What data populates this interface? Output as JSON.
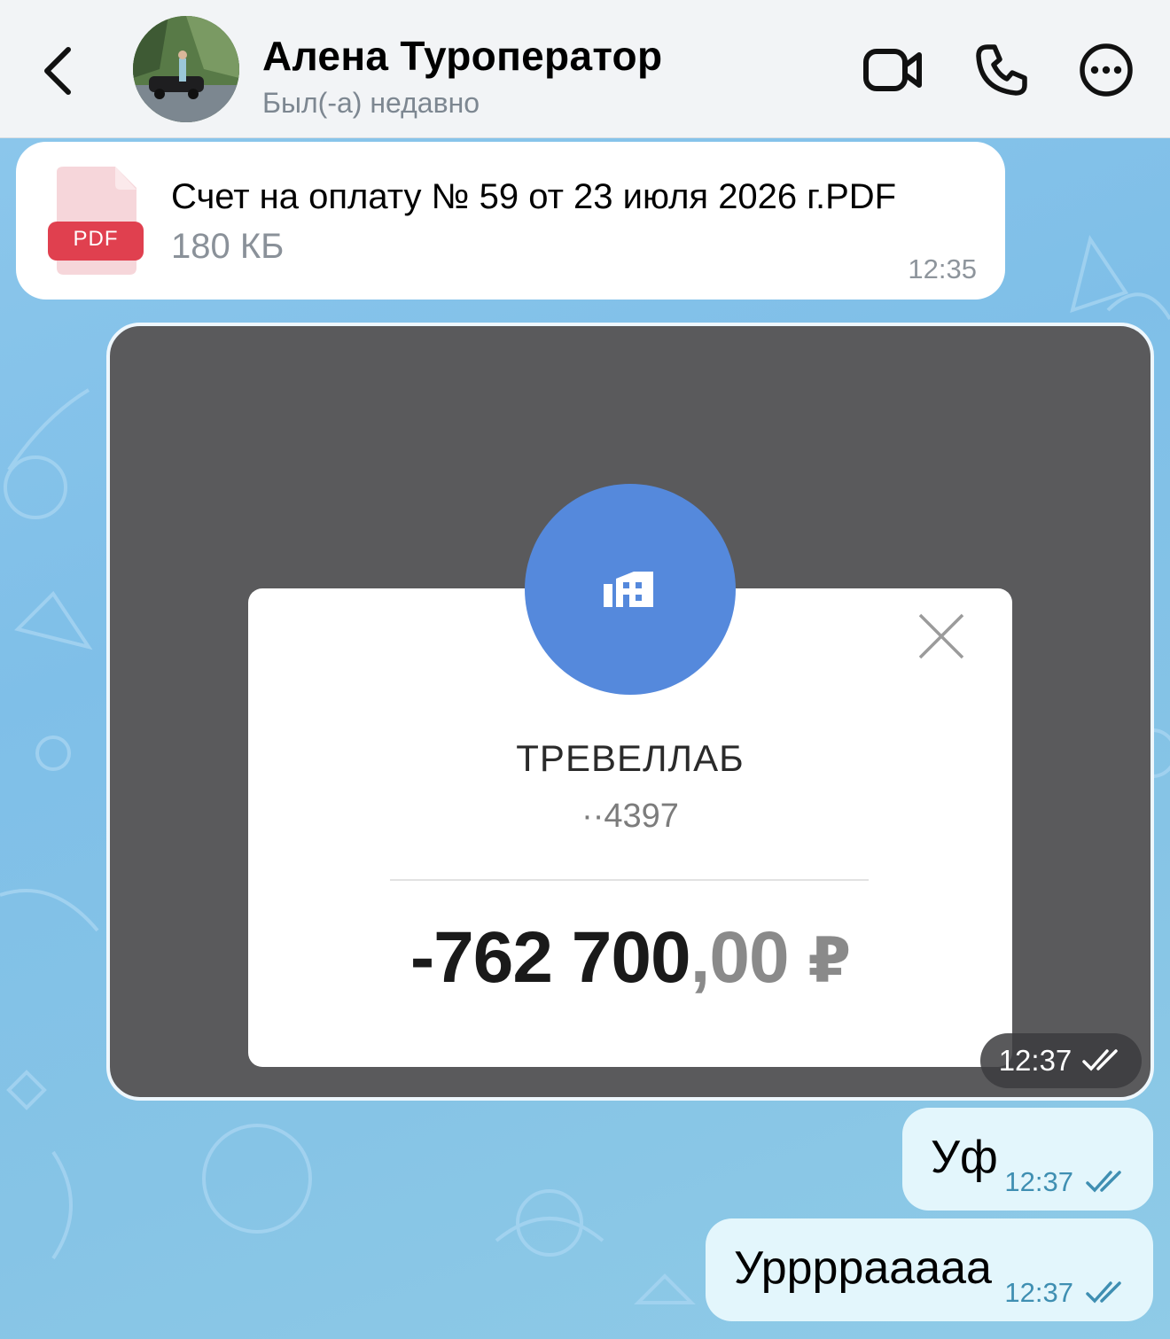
{
  "header": {
    "contact_name": "Алена Туроператор",
    "status": "Был(-а) недавно"
  },
  "messages": {
    "file": {
      "type_badge": "PDF",
      "name": "Счет на оплату № 59 от 23 июля 2026 г.PDF",
      "size": "180 КБ",
      "time": "12:35"
    },
    "image": {
      "time": "12:37",
      "receipt": {
        "merchant": "ТРЕВЕЛЛАБ",
        "account": "··4397",
        "amount_main": "-762 700",
        "amount_kopecks": ",00",
        "currency": "₽"
      }
    },
    "outgoing": [
      {
        "text": "Уф",
        "time": "12:37"
      },
      {
        "text": "Урррраaaaa",
        "time": "12:37"
      }
    ]
  },
  "colors": {
    "header_bg": "#f2f4f6",
    "merchant_circle": "#5589dc",
    "outgoing_bubble": "#e3f6fc",
    "pdf_badge": "#e0404f",
    "check_color": "#3f8fb2"
  }
}
